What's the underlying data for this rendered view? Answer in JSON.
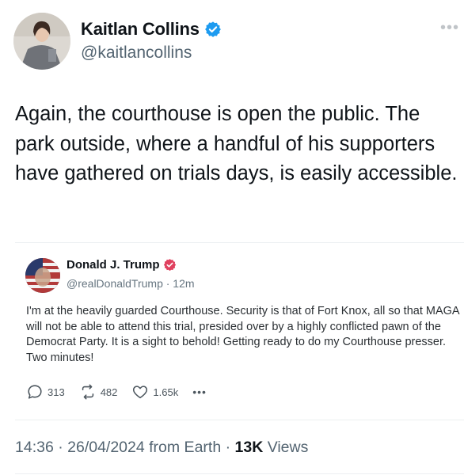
{
  "author": {
    "name": "Kaitlan Collins",
    "handle": "@kaitlancollins"
  },
  "more_icon": "•••",
  "tweet_text": "Again, the courthouse is open the public. The park outside, where a handful of his supporters have gathered on trials days, is easily accessible.",
  "quoted": {
    "name": "Donald J. Trump",
    "handle": "@realDonaldTrump · 12m",
    "text": "I'm at the heavily guarded Courthouse. Security is that of Fort Knox, all so that MAGA will not be able to attend this trial, presided over by a highly conflicted pawn of the Democrat Party. It is a sight to behold! Getting ready to do my Courthouse presser. Two minutes!",
    "replies": "313",
    "retruths": "482",
    "likes": "1.65k",
    "more": "•••"
  },
  "meta": {
    "time_date": "14:36 · 26/04/2024 from Earth · ",
    "views_count": "13K",
    "views_label": " Views"
  },
  "colors": {
    "verified_blue": "#1d9bf0",
    "truth_badge": "#e0415f",
    "secondary_text": "#536471"
  },
  "icons": [
    "avatar",
    "verified-badge-icon",
    "more-icon",
    "truth-verified-badge-icon",
    "reply-icon",
    "retruth-icon",
    "like-icon"
  ]
}
